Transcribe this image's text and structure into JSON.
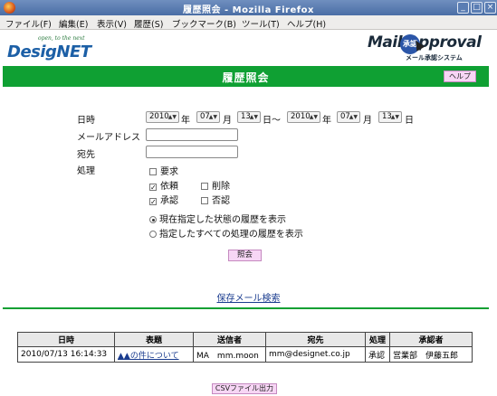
{
  "window": {
    "title": "履歴照会 - Mozilla Firefox",
    "controls": [
      "_",
      "□",
      "×"
    ]
  },
  "menubar": {
    "items": [
      {
        "label": "ファイル(F)"
      },
      {
        "label": "編集(E)"
      },
      {
        "label": "表示(V)"
      },
      {
        "label": "履歴(S)"
      },
      {
        "label": "ブックマーク(B)"
      },
      {
        "label": "ツール(T)"
      },
      {
        "label": "ヘルプ(H)"
      }
    ]
  },
  "header": {
    "left_logo_tagline": "open, to the next",
    "left_logo_name": "DesigNET",
    "right_logo_name": "Mail Approval",
    "right_logo_stamp": "承認",
    "right_logo_sub": "メール承認システム"
  },
  "page": {
    "title": "履歴照会",
    "help_label": "ヘルプ"
  },
  "form": {
    "datetime_label": "日時",
    "from": {
      "year": "2010",
      "month": "07",
      "day": "13"
    },
    "to": {
      "year": "2010",
      "month": "07",
      "day": "13"
    },
    "unit_year": "年",
    "unit_month": "月",
    "unit_day_range": "日～",
    "unit_day": "日",
    "mail_address_label": "メールアドレス",
    "mail_address_value": "",
    "recipient_label": "宛先",
    "recipient_value": "",
    "process_label": "処理",
    "checks": {
      "request": {
        "label": "要求",
        "checked": false
      },
      "asked": {
        "label": "依頼",
        "checked": true
      },
      "delete": {
        "label": "削除",
        "checked": false
      },
      "approve": {
        "label": "承認",
        "checked": true
      },
      "reject": {
        "label": "否認",
        "checked": false
      }
    },
    "radio_current": "現在指定した状態の履歴を表示",
    "radio_all": "指定したすべての処理の履歴を表示",
    "radio_selected": "current",
    "query_button": "照会"
  },
  "saved_search_link": "保存メール検索",
  "results": {
    "headers": [
      "日時",
      "表題",
      "送信者",
      "宛先",
      "処理",
      "承認者"
    ],
    "rows": [
      [
        "2010/07/13 16:14:33",
        "▲▲の件について",
        "MA　mm.moon",
        "mm@designet.co.jp",
        "承認",
        "営業部　伊藤五郎"
      ]
    ]
  },
  "csv_button": "CSVファイル出力",
  "colors": {
    "accent_green": "#0fa033",
    "button_pink": "#f7d6f5",
    "link_blue": "#1a3c8f"
  }
}
